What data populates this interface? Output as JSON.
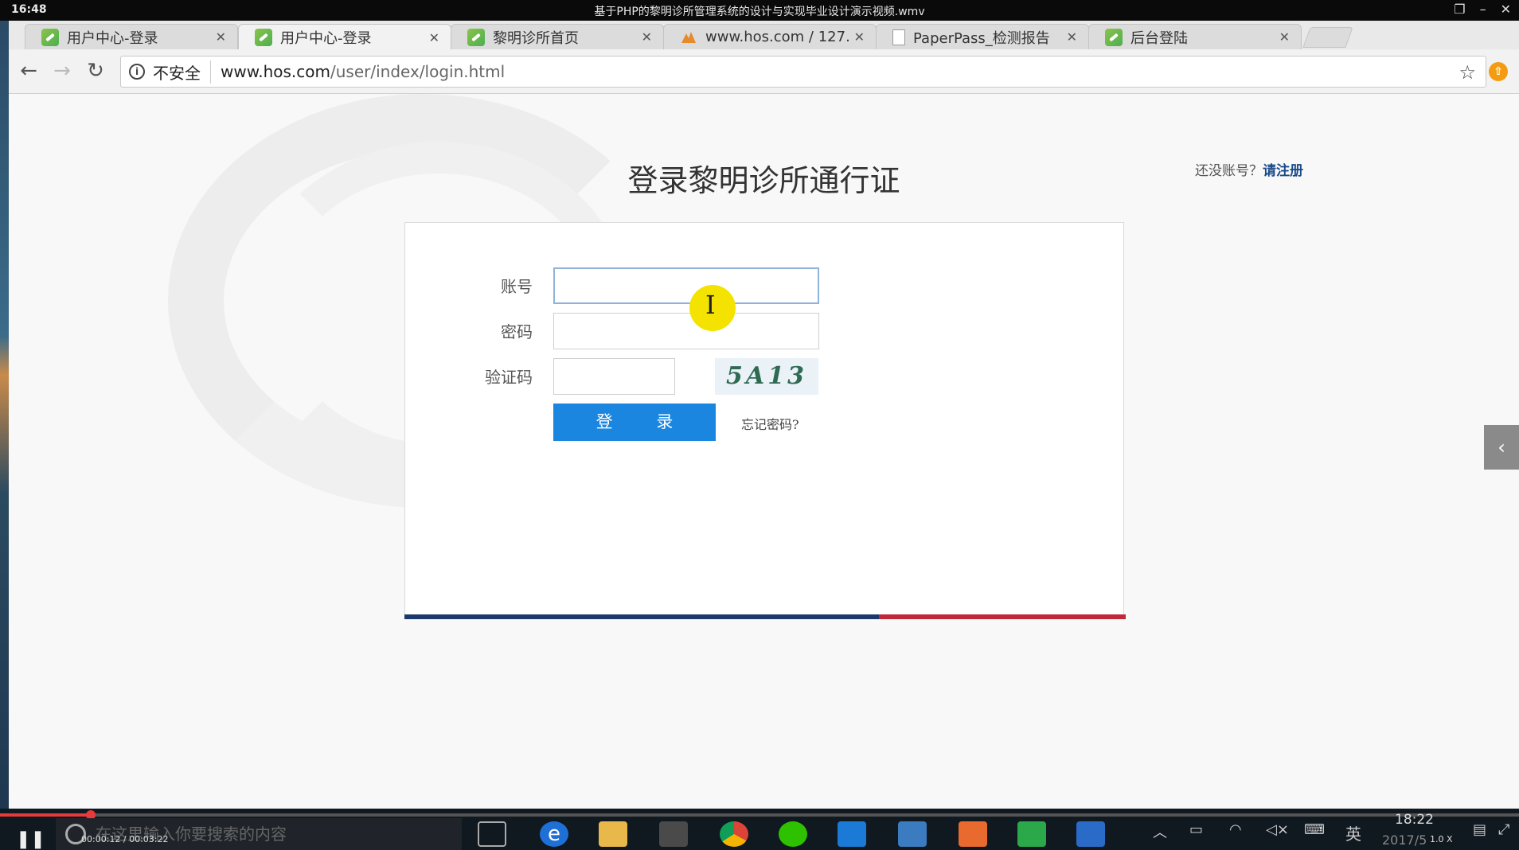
{
  "player": {
    "clock": "16:48",
    "title": "基于PHP的黎明诊所管理系统的设计与实现毕业设计演示视频.wmv",
    "elapsed": "00:00:12 / 00:03:22",
    "speed": "1.0 X",
    "progress_fraction": 0.06
  },
  "browser": {
    "tabs": [
      {
        "label": "用户中心-登录",
        "icon": "leaf-favicon-icon"
      },
      {
        "label": "用户中心-登录",
        "icon": "leaf-favicon-icon"
      },
      {
        "label": "黎明诊所首页",
        "icon": "leaf-favicon-icon"
      },
      {
        "label": "www.hos.com / 127.",
        "icon": "phpmyadmin-favicon-icon"
      },
      {
        "label": "PaperPass_检测报告",
        "icon": "document-icon"
      },
      {
        "label": "后台登陆",
        "icon": "leaf-favicon-icon"
      }
    ],
    "security_text": "不安全",
    "url_host": "www.hos.com",
    "url_path": "/user/index/login.html"
  },
  "page": {
    "title": "登录黎明诊所通行证",
    "register_prompt": "还没账号？",
    "register_link": "请注册",
    "account_label": "账号",
    "password_label": "密码",
    "captcha_label": "验证码",
    "captcha_text": "5A13",
    "login_button": "登 录",
    "forgot_link": "忘记密码?",
    "colors": {
      "button": "#1a86e0",
      "bar_left": "#1b3a6b",
      "bar_right": "#c0283a"
    }
  },
  "taskbar": {
    "search_placeholder": "在这里输入你要搜索的内容",
    "ime": "英",
    "time": "18:22",
    "date": "2017/5"
  }
}
